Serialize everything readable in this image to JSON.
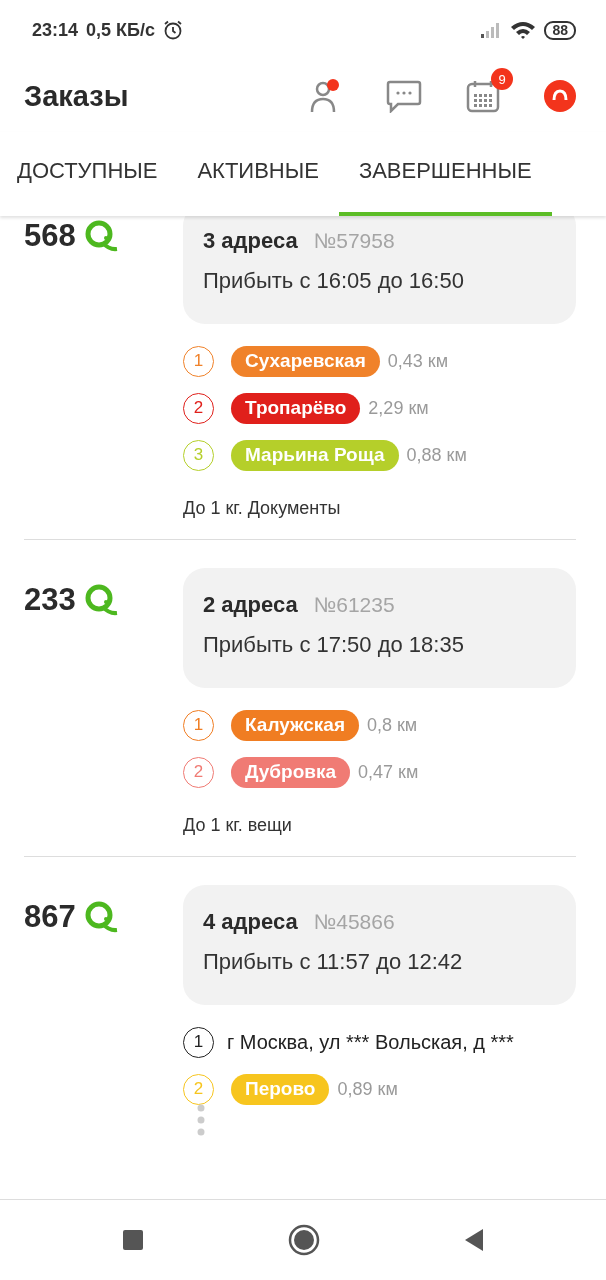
{
  "status_bar": {
    "time": "23:14",
    "speed": "0,5 КБ/с",
    "battery": "88"
  },
  "header": {
    "title": "Заказы",
    "profile_notification": true,
    "calendar_badge": "9"
  },
  "tabs": [
    {
      "label": "ДОСТУПНЫЕ",
      "selected": false
    },
    {
      "label": "АКТИВНЫЕ",
      "selected": false
    },
    {
      "label": "ЗАВЕРШЕННЫЕ",
      "selected": true
    }
  ],
  "orders": [
    {
      "price": "568",
      "addresses": "3 адреса",
      "number": "№57958",
      "arrival": "Прибыть с 16:05 до 16:50",
      "stops": [
        {
          "kind": "metro",
          "index": "1",
          "name": "Сухаревская",
          "distance": "0,43 км",
          "color": "#f0822a"
        },
        {
          "kind": "metro",
          "index": "2",
          "name": "Тропарёво",
          "distance": "2,29 км",
          "color": "#e0201b"
        },
        {
          "kind": "metro",
          "index": "3",
          "name": "Марьина Роща",
          "distance": "0,88 км",
          "color": "#b5cf2a"
        }
      ],
      "more_stops": false,
      "note": "До 1 кг. Документы"
    },
    {
      "price": "233",
      "addresses": "2 адреса",
      "number": "№61235",
      "arrival": "Прибыть с 17:50 до 18:35",
      "stops": [
        {
          "kind": "metro",
          "index": "1",
          "name": "Калужская",
          "distance": "0,8 км",
          "color": "#f07d22"
        },
        {
          "kind": "metro",
          "index": "2",
          "name": "Дубровка",
          "distance": "0,47 км",
          "color": "#f07b74"
        }
      ],
      "more_stops": false,
      "note": "До 1 кг. вещи"
    },
    {
      "price": "867",
      "addresses": "4 адреса",
      "number": "№45866",
      "arrival": "Прибыть с 11:57 до 12:42",
      "stops": [
        {
          "kind": "address",
          "index": "1",
          "name": "г Москва, ул *** Вольская, д ***",
          "color": "#222222"
        },
        {
          "kind": "metro",
          "index": "2",
          "name": "Перово",
          "distance": "0,89 км",
          "color": "#f7c51e"
        }
      ],
      "more_stops": true
    }
  ]
}
